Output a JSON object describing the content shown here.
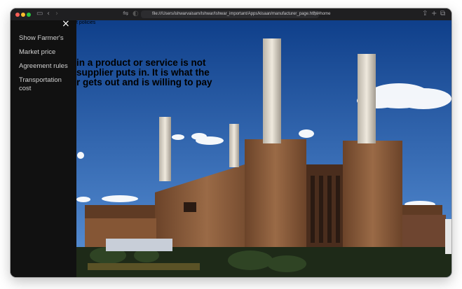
{
  "browser": {
    "url": "file:///Users/ishwarvaisam/Ishwar/Ishwar_important/Apps/kisaan/manufacturer_page.html#home",
    "traffic_lights": {
      "close": "#ff5f57",
      "minimize": "#febc2e",
      "maximize": "#28c840"
    }
  },
  "sidenav": {
    "close_symbol": "×",
    "items": [
      {
        "label": "Show Farmer's"
      },
      {
        "label": "Market price"
      },
      {
        "label": "Agreement rules"
      },
      {
        "label": "Transportation cost"
      }
    ]
  },
  "page": {
    "breadcrumb": "t policies",
    "headline_lines": [
      "in a product or service is not",
      "supplier puts in. It is what the",
      "r gets out and is willing to pay"
    ]
  },
  "colors": {
    "sky": "#3d7fc7",
    "brick": "#8a5a3a",
    "sidenav_bg": "#111111",
    "sidenav_text": "#d0d0d0"
  }
}
